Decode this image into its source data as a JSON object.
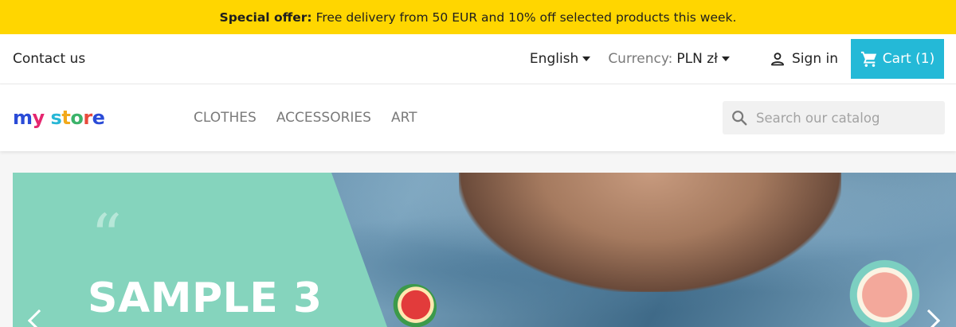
{
  "banner": {
    "label": "Special offer:",
    "text": "Free delivery from 50 EUR and 10% off selected products this week."
  },
  "header": {
    "contact": "Contact us",
    "language": "English",
    "currency_label": "Currency:",
    "currency_value": "PLN zł",
    "signin": "Sign in",
    "cart": "Cart (1)",
    "cart_color": "#24b9d7"
  },
  "logo": {
    "text": "my store"
  },
  "nav": {
    "items": [
      "CLOTHES",
      "ACCESSORIES",
      "ART"
    ]
  },
  "search": {
    "placeholder": "Search our catalog",
    "value": ""
  },
  "slider": {
    "quote_mark": "“",
    "title": "SAMPLE 3",
    "panel_color": "#85d4bd"
  },
  "colors": {
    "banner_bg": "#ffd600"
  }
}
